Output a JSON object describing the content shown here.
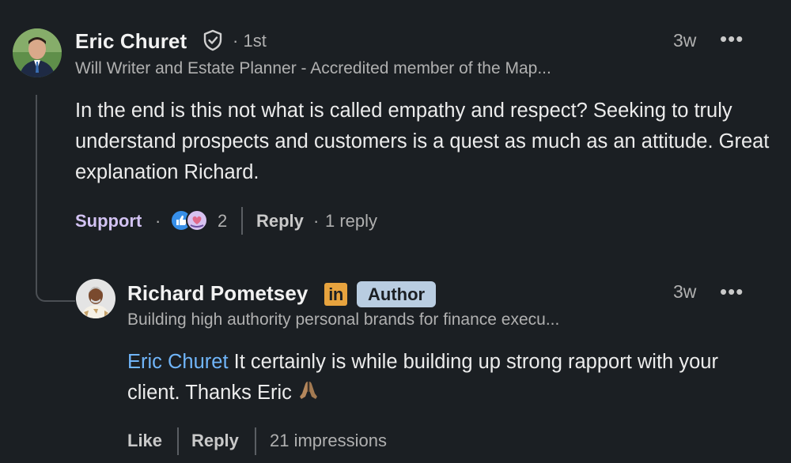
{
  "comment": {
    "author": "Eric Churet",
    "degree": "1st",
    "headline": "Will Writer and Estate Planner - Accredited member of the Map...",
    "time": "3w",
    "text": "In the end is this not what is called empathy and respect? Seeking to truly understand prospects and customers is a quest as much as an attitude. Great explanation Richard.",
    "reaction_label": "Support",
    "reaction_count": "2",
    "reply_label": "Reply",
    "replies": "1 reply"
  },
  "reply": {
    "author": "Richard Pometsey",
    "linkedin_badge": "in",
    "author_badge": "Author",
    "headline": "Building high authority personal brands for finance execu...",
    "time": "3w",
    "mention": "Eric Churet",
    "text": " It certainly is while building up strong rapport with your client. Thanks Eric ",
    "like_label": "Like",
    "reply_label": "Reply",
    "impressions": "21 impressions"
  },
  "colors": {
    "background": "#1b1f23",
    "mention": "#70b5f9",
    "support": "#d2c2f2",
    "author_badge": "#b9cde1",
    "linkedin_badge": "#e7a33e"
  },
  "icons": [
    "verified-shield-icon",
    "more-options-icon",
    "reaction-icons",
    "linkedin-badge-icon",
    "folded-hands-emoji"
  ]
}
